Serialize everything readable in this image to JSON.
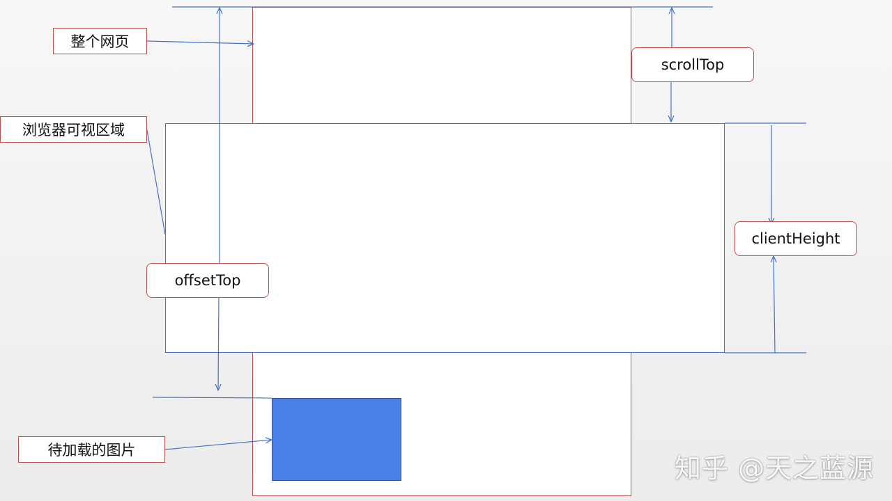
{
  "labels": {
    "whole_page": "整个网页",
    "viewport": "浏览器可视区域",
    "lazy_image": "待加载的图片",
    "scroll_top": "scrollTop",
    "client_height": "clientHeight",
    "offset_top": "offsetTop"
  },
  "watermark": "知乎 @天之蓝源",
  "colors": {
    "page_border": "#c0504d",
    "viewport_border": "#4472c4",
    "image_fill": "#4a7fe8",
    "arrow": "#4472c4"
  }
}
